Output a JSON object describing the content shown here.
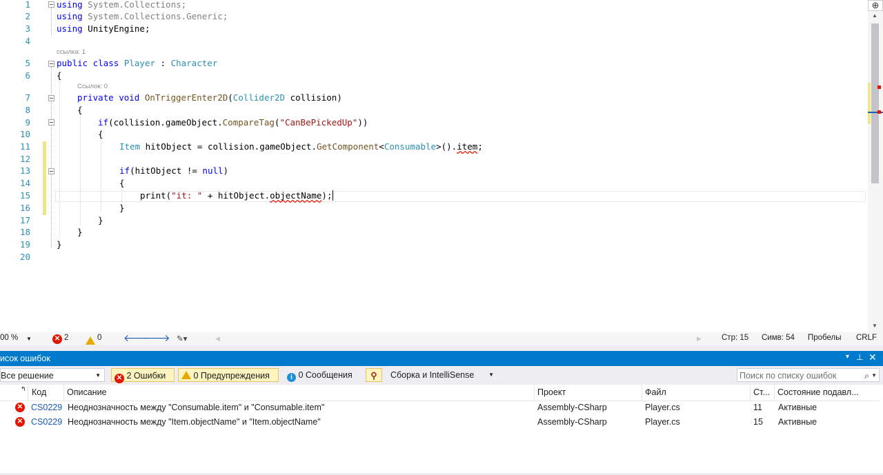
{
  "editor": {
    "line_numbers": [
      "1",
      "2",
      "3",
      "4",
      "5",
      "6",
      "7",
      "8",
      "9",
      "10",
      "11",
      "12",
      "13",
      "14",
      "15",
      "16",
      "17",
      "18",
      "19",
      "20"
    ],
    "codelens_class": "ссылка: 1",
    "codelens_method": "Ссылок: 0",
    "lines": {
      "l1_kw": "using",
      "l1_rest": " System.Collections;",
      "l2_kw": "using",
      "l2_rest": " System.Collections.Generic;",
      "l3_kw": "using",
      "l3_rest": " UnityEngine;",
      "l5_kw1": "public",
      "l5_kw2": " class",
      "l5_type1": " Player",
      "l5_colon": " : ",
      "l5_type2": "Character",
      "l6": "{",
      "l7_kw1": "private",
      "l7_kw2": " void",
      "l7_method": " OnTriggerEnter2D",
      "l7_p1": "(",
      "l7_type": "Collider2D",
      "l7_p2": " collision)",
      "l8": "{",
      "l9_kw": "if",
      "l9_a": "(collision.gameObject.",
      "l9_m": "CompareTag",
      "l9_b": "(",
      "l9_str": "\"CanBePickedUp\"",
      "l9_c": "))",
      "l10": "{",
      "l11_type": "Item",
      "l11_a": " hitObject = collision.gameObject.",
      "l11_m": "GetComponent",
      "l11_b": "<",
      "l11_type2": "Consumable",
      "l11_c": ">().",
      "l11_sq": "item",
      "l11_d": ";",
      "l13_kw": "if",
      "l13_a": "(hitObject != ",
      "l13_kw2": "null",
      "l13_b": ")",
      "l14": "{",
      "l15_a": "print(",
      "l15_str": "\"it: \"",
      "l15_b": " + hitObject.",
      "l15_sq": "objectName",
      "l15_c": ");",
      "l16": "}",
      "l17": "}",
      "l18": "}",
      "l19": "}"
    }
  },
  "status_bar": {
    "zoom": "00 %",
    "errors_count": "2",
    "warnings_count": "0",
    "line": "Стр: 15",
    "col": "Симв: 54",
    "whitespace": "Пробелы",
    "eol": "CRLF"
  },
  "error_panel": {
    "title": "исок ошибок",
    "scope": "Все решение",
    "errors_filter": "2 Ошибки",
    "warnings_filter": "0 Предупреждения",
    "messages_filter": "0 Сообщения",
    "build_filter": "Сборка и IntelliSense",
    "search_placeholder": "Поиск по списку ошибок",
    "columns": {
      "code": "Код",
      "description": "Описание",
      "project": "Проект",
      "file": "Файл",
      "line": "Ст...",
      "suppression": "Состояние подавл..."
    },
    "rows": [
      {
        "code": "CS0229",
        "description": "Неоднозначность между \"Consumable.item\" и \"Consumable.item\"",
        "project": "Assembly-CSharp",
        "file": "Player.cs",
        "line": "11",
        "state": "Активные"
      },
      {
        "code": "CS0229",
        "description": "Неоднозначность между \"Item.objectName\" и \"Item.objectName\"",
        "project": "Assembly-CSharp",
        "file": "Player.cs",
        "line": "15",
        "state": "Активные"
      }
    ]
  },
  "colors": {
    "keyword": "#0000ff",
    "type": "#2b91af",
    "string": "#a31515",
    "method": "#74531f",
    "error": "#e51400",
    "panel_header": "#007acc"
  }
}
